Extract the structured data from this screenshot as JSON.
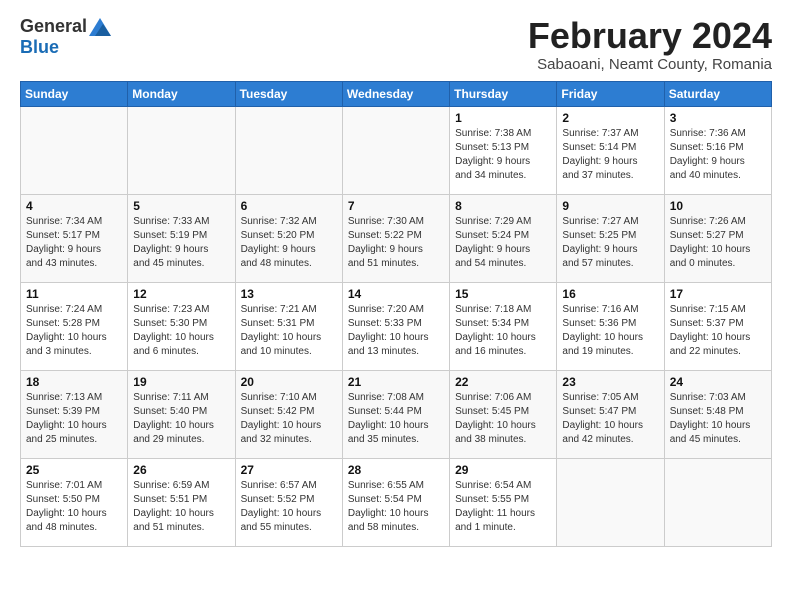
{
  "logo": {
    "general": "General",
    "blue": "Blue"
  },
  "title": "February 2024",
  "subtitle": "Sabaoani, Neamt County, Romania",
  "headers": [
    "Sunday",
    "Monday",
    "Tuesday",
    "Wednesday",
    "Thursday",
    "Friday",
    "Saturday"
  ],
  "weeks": [
    [
      {
        "day": "",
        "info": ""
      },
      {
        "day": "",
        "info": ""
      },
      {
        "day": "",
        "info": ""
      },
      {
        "day": "",
        "info": ""
      },
      {
        "day": "1",
        "info": "Sunrise: 7:38 AM\nSunset: 5:13 PM\nDaylight: 9 hours\nand 34 minutes."
      },
      {
        "day": "2",
        "info": "Sunrise: 7:37 AM\nSunset: 5:14 PM\nDaylight: 9 hours\nand 37 minutes."
      },
      {
        "day": "3",
        "info": "Sunrise: 7:36 AM\nSunset: 5:16 PM\nDaylight: 9 hours\nand 40 minutes."
      }
    ],
    [
      {
        "day": "4",
        "info": "Sunrise: 7:34 AM\nSunset: 5:17 PM\nDaylight: 9 hours\nand 43 minutes."
      },
      {
        "day": "5",
        "info": "Sunrise: 7:33 AM\nSunset: 5:19 PM\nDaylight: 9 hours\nand 45 minutes."
      },
      {
        "day": "6",
        "info": "Sunrise: 7:32 AM\nSunset: 5:20 PM\nDaylight: 9 hours\nand 48 minutes."
      },
      {
        "day": "7",
        "info": "Sunrise: 7:30 AM\nSunset: 5:22 PM\nDaylight: 9 hours\nand 51 minutes."
      },
      {
        "day": "8",
        "info": "Sunrise: 7:29 AM\nSunset: 5:24 PM\nDaylight: 9 hours\nand 54 minutes."
      },
      {
        "day": "9",
        "info": "Sunrise: 7:27 AM\nSunset: 5:25 PM\nDaylight: 9 hours\nand 57 minutes."
      },
      {
        "day": "10",
        "info": "Sunrise: 7:26 AM\nSunset: 5:27 PM\nDaylight: 10 hours\nand 0 minutes."
      }
    ],
    [
      {
        "day": "11",
        "info": "Sunrise: 7:24 AM\nSunset: 5:28 PM\nDaylight: 10 hours\nand 3 minutes."
      },
      {
        "day": "12",
        "info": "Sunrise: 7:23 AM\nSunset: 5:30 PM\nDaylight: 10 hours\nand 6 minutes."
      },
      {
        "day": "13",
        "info": "Sunrise: 7:21 AM\nSunset: 5:31 PM\nDaylight: 10 hours\nand 10 minutes."
      },
      {
        "day": "14",
        "info": "Sunrise: 7:20 AM\nSunset: 5:33 PM\nDaylight: 10 hours\nand 13 minutes."
      },
      {
        "day": "15",
        "info": "Sunrise: 7:18 AM\nSunset: 5:34 PM\nDaylight: 10 hours\nand 16 minutes."
      },
      {
        "day": "16",
        "info": "Sunrise: 7:16 AM\nSunset: 5:36 PM\nDaylight: 10 hours\nand 19 minutes."
      },
      {
        "day": "17",
        "info": "Sunrise: 7:15 AM\nSunset: 5:37 PM\nDaylight: 10 hours\nand 22 minutes."
      }
    ],
    [
      {
        "day": "18",
        "info": "Sunrise: 7:13 AM\nSunset: 5:39 PM\nDaylight: 10 hours\nand 25 minutes."
      },
      {
        "day": "19",
        "info": "Sunrise: 7:11 AM\nSunset: 5:40 PM\nDaylight: 10 hours\nand 29 minutes."
      },
      {
        "day": "20",
        "info": "Sunrise: 7:10 AM\nSunset: 5:42 PM\nDaylight: 10 hours\nand 32 minutes."
      },
      {
        "day": "21",
        "info": "Sunrise: 7:08 AM\nSunset: 5:44 PM\nDaylight: 10 hours\nand 35 minutes."
      },
      {
        "day": "22",
        "info": "Sunrise: 7:06 AM\nSunset: 5:45 PM\nDaylight: 10 hours\nand 38 minutes."
      },
      {
        "day": "23",
        "info": "Sunrise: 7:05 AM\nSunset: 5:47 PM\nDaylight: 10 hours\nand 42 minutes."
      },
      {
        "day": "24",
        "info": "Sunrise: 7:03 AM\nSunset: 5:48 PM\nDaylight: 10 hours\nand 45 minutes."
      }
    ],
    [
      {
        "day": "25",
        "info": "Sunrise: 7:01 AM\nSunset: 5:50 PM\nDaylight: 10 hours\nand 48 minutes."
      },
      {
        "day": "26",
        "info": "Sunrise: 6:59 AM\nSunset: 5:51 PM\nDaylight: 10 hours\nand 51 minutes."
      },
      {
        "day": "27",
        "info": "Sunrise: 6:57 AM\nSunset: 5:52 PM\nDaylight: 10 hours\nand 55 minutes."
      },
      {
        "day": "28",
        "info": "Sunrise: 6:55 AM\nSunset: 5:54 PM\nDaylight: 10 hours\nand 58 minutes."
      },
      {
        "day": "29",
        "info": "Sunrise: 6:54 AM\nSunset: 5:55 PM\nDaylight: 11 hours\nand 1 minute."
      },
      {
        "day": "",
        "info": ""
      },
      {
        "day": "",
        "info": ""
      }
    ]
  ]
}
